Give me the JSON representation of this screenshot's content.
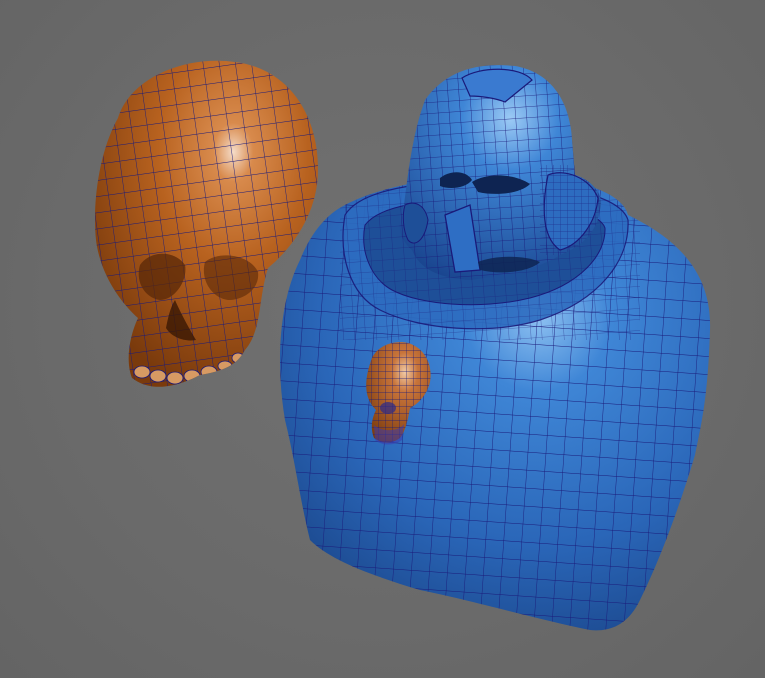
{
  "viewport": {
    "background": "#6b6b6b",
    "wire_color": "#1a1a7a",
    "models": [
      {
        "name": "skull",
        "color": "#b8621f",
        "highlight": "#f1d6bf"
      },
      {
        "name": "space-marine-torso",
        "color": "#2a66b8",
        "highlight": "#8fc2f2"
      },
      {
        "name": "skull-emblem",
        "color": "#b8621f",
        "highlight": "#f0c9a4"
      }
    ]
  }
}
